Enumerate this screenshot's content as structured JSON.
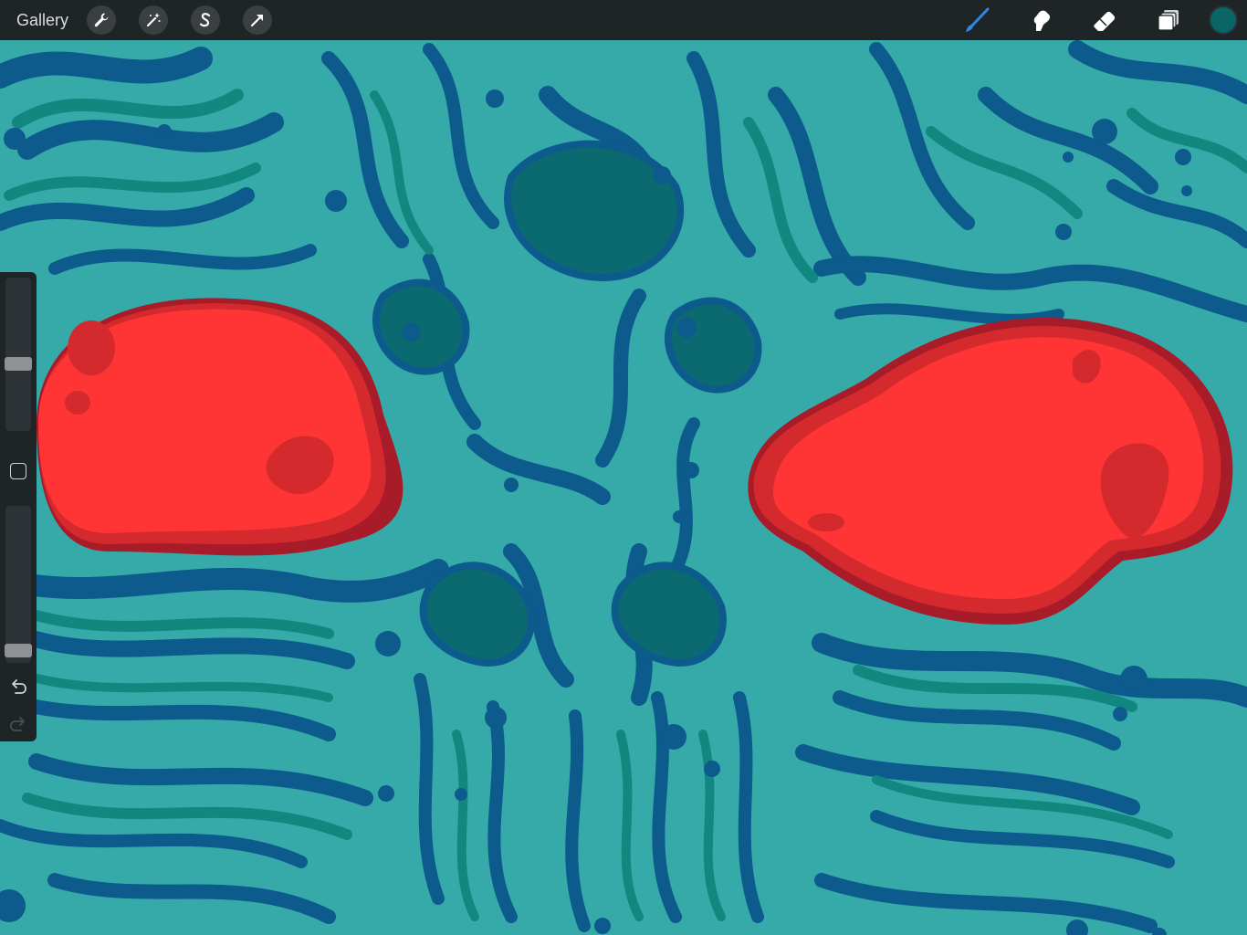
{
  "app": {
    "gallery_label": "Gallery"
  },
  "toolbar_left": [
    {
      "name": "actions-wrench-icon"
    },
    {
      "name": "adjustments-wand-icon"
    },
    {
      "name": "selection-s-icon"
    },
    {
      "name": "transform-arrow-icon"
    }
  ],
  "toolbar_right": [
    {
      "name": "brush-icon",
      "active": true
    },
    {
      "name": "smudge-icon",
      "active": false
    },
    {
      "name": "eraser-icon",
      "active": false
    },
    {
      "name": "layers-icon",
      "active": false
    }
  ],
  "current_color": "#0a6566",
  "sidebar": {
    "brush_size_level": 0.43,
    "opacity_level": 0.04
  },
  "colors": {
    "background": "#35aaa8",
    "dark_blue": "#0d5a8c",
    "mid_teal": "#128780",
    "deep_teal": "#0b6a70",
    "red": "#ff3535",
    "red_shadow": "#d42a2e",
    "red_dark": "#a81c2a",
    "active_tool": "#2f86e8"
  }
}
